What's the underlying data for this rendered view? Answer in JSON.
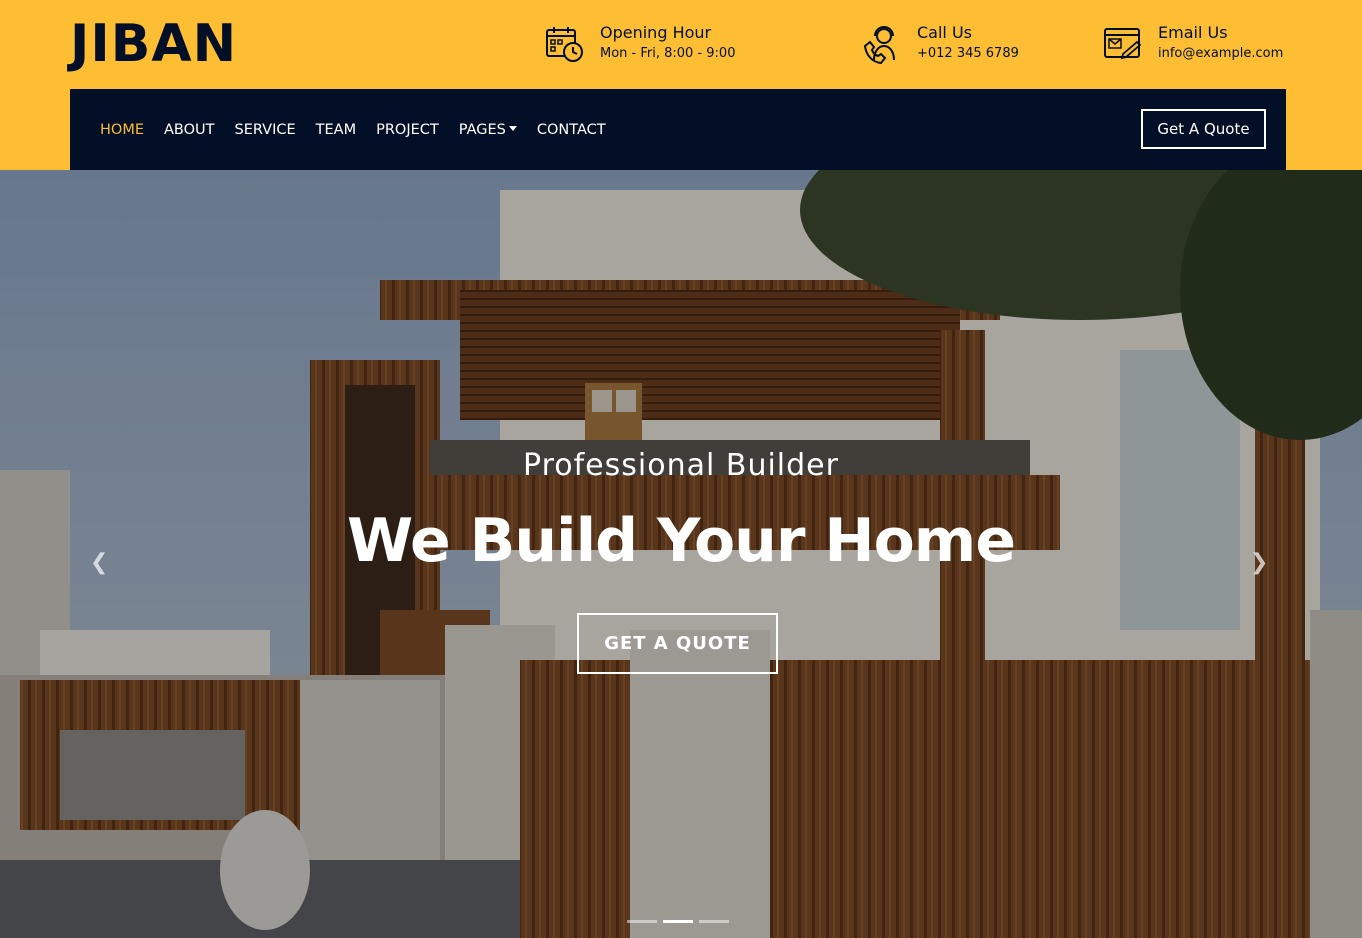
{
  "brand": {
    "logo": "JIBAN"
  },
  "contact": {
    "hours": {
      "title": "Opening Hour",
      "value": "Mon - Fri, 8:00 - 9:00",
      "icon": "calendar-clock-icon"
    },
    "call": {
      "title": "Call Us",
      "value": "+012 345 6789",
      "icon": "support-agent-icon"
    },
    "email": {
      "title": "Email Us",
      "value": "info@example.com",
      "icon": "mail-icon"
    }
  },
  "nav": {
    "items": [
      {
        "label": "HOME",
        "active": true
      },
      {
        "label": "ABOUT"
      },
      {
        "label": "SERVICE"
      },
      {
        "label": "TEAM"
      },
      {
        "label": "PROJECT"
      },
      {
        "label": "PAGES",
        "dropdown": true
      },
      {
        "label": "CONTACT"
      }
    ],
    "quote_label": "Get A Quote"
  },
  "hero": {
    "subtitle": "Professional Builder",
    "title": "We Build Your Home",
    "cta_label": "GET A QUOTE",
    "active_slide": 2,
    "slide_count": 3
  },
  "colors": {
    "accent": "#FDBE33",
    "navy": "#030F27",
    "white": "#FFFFFF"
  }
}
